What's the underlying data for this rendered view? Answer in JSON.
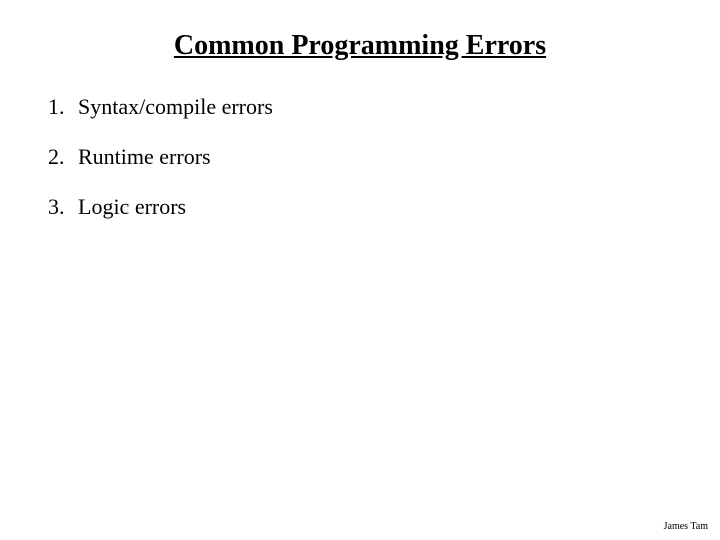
{
  "title": "Common Programming Errors",
  "items": [
    {
      "number": "1.",
      "text": "Syntax/compile errors"
    },
    {
      "number": "2.",
      "text": "Runtime errors"
    },
    {
      "number": "3.",
      "text": "Logic errors"
    }
  ],
  "footer": "James Tam"
}
